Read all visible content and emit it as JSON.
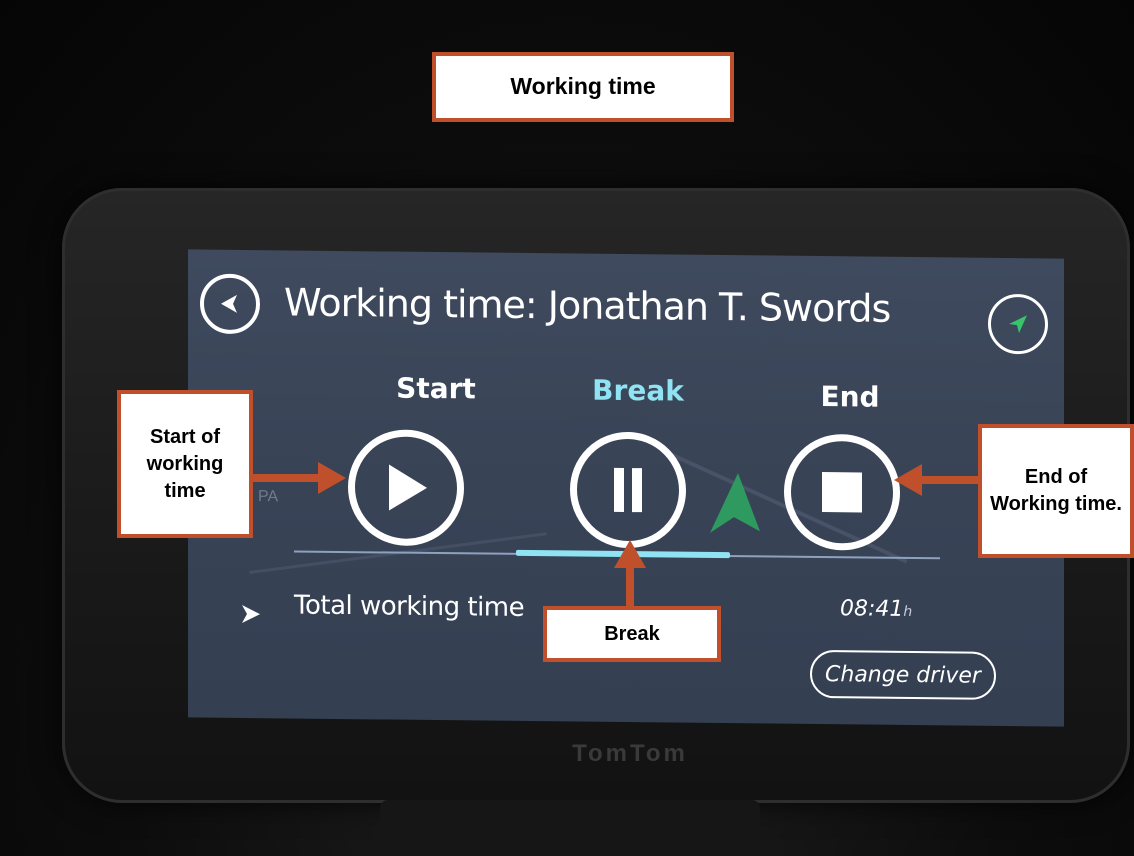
{
  "annotations": {
    "title": "Working time",
    "start": "Start of working time",
    "break": "Break",
    "end": "End of Working time."
  },
  "device": {
    "brand": "TomTom"
  },
  "screen": {
    "title": "Working time: Jonathan T. Swords",
    "map_label": "PA",
    "controls": {
      "start_label": "Start",
      "break_label": "Break",
      "end_label": "End"
    },
    "total": {
      "label": "Total working time",
      "value": "08:41",
      "unit": "h"
    },
    "change_driver": "Change driver"
  },
  "colors": {
    "accent_break": "#8fe3f2",
    "callout_border": "#c0502b",
    "nav_arrow": "#37c46b"
  },
  "icons": {
    "back": "back-arrow-icon",
    "nav": "navigation-arrow-icon",
    "start": "play-icon",
    "break": "pause-icon",
    "end": "stop-icon",
    "row": "chevron-right-icon"
  }
}
